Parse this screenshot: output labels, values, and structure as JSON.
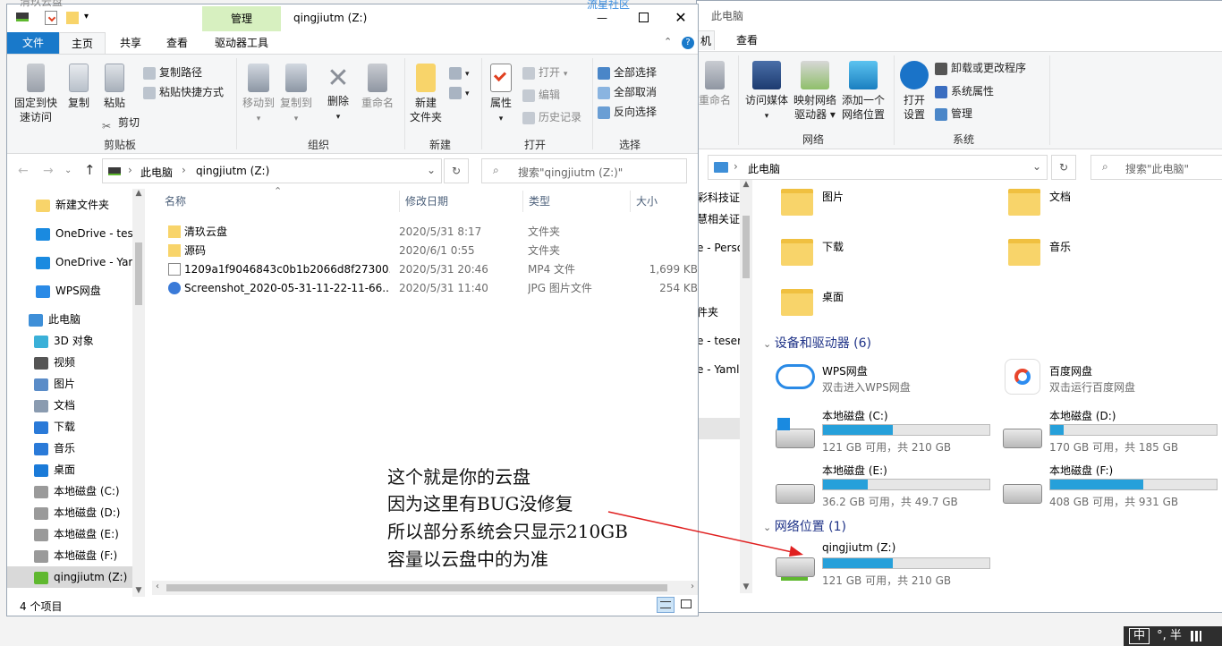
{
  "colors": {
    "accent": "#1979ca",
    "drive_fill": "#26a0da",
    "manage_tab": "#d7f0c0",
    "arrow": "#e02020"
  },
  "back_window": {
    "title": "此电脑",
    "tabs": [
      "机",
      "查看"
    ],
    "ribbon": {
      "rename": "重命名",
      "access_media": "访问媒体",
      "map_drive_1": "映射网络",
      "map_drive_2": "驱动器",
      "add_location_1": "添加一个",
      "add_location_2": "网络位置",
      "open_settings_1": "打开",
      "open_settings_2": "设置",
      "uninstall": "卸载或更改程序",
      "system_props": "系统属性",
      "manage": "管理",
      "group_network": "网络",
      "group_system": "系统"
    },
    "address": "此电脑",
    "search_placeholder": "搜索\"此电脑\"",
    "nav_partial": [
      "彩科技证",
      "慧相关证",
      "e - Perso",
      "件夹",
      "e - teser",
      "e - Yaml"
    ],
    "folders": [
      {
        "name": "图片"
      },
      {
        "name": "文档"
      },
      {
        "name": "下载"
      },
      {
        "name": "音乐"
      },
      {
        "name": "桌面"
      }
    ],
    "devices_title": "设备和驱动器 (6)",
    "cloud": [
      {
        "name": "WPS网盘",
        "sub": "双击进入WPS网盘"
      },
      {
        "name": "百度网盘",
        "sub": "双击运行百度网盘"
      }
    ],
    "drives": [
      {
        "name": "本地磁盘 (C:)",
        "sub": "121 GB 可用，共 210 GB",
        "used": 0.42
      },
      {
        "name": "本地磁盘 (D:)",
        "sub": "170 GB 可用，共 185 GB",
        "used": 0.08
      },
      {
        "name": "本地磁盘 (E:)",
        "sub": "36.2 GB 可用，共 49.7 GB",
        "used": 0.27
      },
      {
        "name": "本地磁盘 (F:)",
        "sub": "408 GB 可用，共 931 GB",
        "used": 0.56
      }
    ],
    "network_title": "网络位置 (1)",
    "network_drive": {
      "name": "qingjiutm (Z:)",
      "sub": "121 GB 可用，共 210 GB",
      "used": 0.42
    }
  },
  "front_window": {
    "title": "qingjiutm (Z:)",
    "manage_tab": "管理",
    "tabs": [
      "文件",
      "主页",
      "共享",
      "查看",
      "驱动器工具"
    ],
    "ribbon": {
      "pin_1": "固定到快",
      "pin_2": "速访问",
      "copy": "复制",
      "paste": "粘贴",
      "copy_path": "复制路径",
      "paste_shortcut": "粘贴快捷方式",
      "cut": "剪切",
      "group_clipboard": "剪贴板",
      "move_to": "移动到",
      "copy_to": "复制到",
      "delete": "删除",
      "rename": "重命名",
      "group_organize": "组织",
      "new_folder_1": "新建",
      "new_folder_2": "文件夹",
      "group_new": "新建",
      "properties": "属性",
      "open": "打开",
      "edit": "编辑",
      "history": "历史记录",
      "group_open": "打开",
      "select_all": "全部选择",
      "select_none": "全部取消",
      "invert": "反向选择",
      "group_select": "选择"
    },
    "breadcrumb": [
      "此电脑",
      "qingjiutm (Z:)"
    ],
    "search_placeholder": "搜索\"qingjiutm (Z:)\"",
    "nav": [
      {
        "label": "新建文件夹",
        "icon": "folder-icon"
      },
      {
        "label": "OneDrive - teser",
        "icon": "cloud-icon"
      },
      {
        "label": "OneDrive - Yaml",
        "icon": "cloud-icon"
      },
      {
        "label": "WPS网盘",
        "icon": "wps-cloud-icon"
      },
      {
        "label": "此电脑",
        "icon": "computer-icon"
      },
      {
        "label": "3D 对象",
        "icon": "cube-icon"
      },
      {
        "label": "视频",
        "icon": "video-icon"
      },
      {
        "label": "图片",
        "icon": "picture-icon"
      },
      {
        "label": "文档",
        "icon": "document-icon"
      },
      {
        "label": "下载",
        "icon": "download-icon"
      },
      {
        "label": "音乐",
        "icon": "music-icon"
      },
      {
        "label": "桌面",
        "icon": "desktop-icon"
      },
      {
        "label": "本地磁盘 (C:)",
        "icon": "drive-icon"
      },
      {
        "label": "本地磁盘 (D:)",
        "icon": "drive-icon"
      },
      {
        "label": "本地磁盘 (E:)",
        "icon": "drive-icon"
      },
      {
        "label": "本地磁盘 (F:)",
        "icon": "drive-icon"
      },
      {
        "label": "qingjiutm (Z:)",
        "icon": "network-drive-icon"
      }
    ],
    "columns": [
      "名称",
      "修改日期",
      "类型",
      "大小"
    ],
    "files": [
      {
        "name": "清玖云盘",
        "date": "2020/5/31 8:17",
        "type": "文件夹",
        "size": "",
        "icon": "folder-icon"
      },
      {
        "name": "源码",
        "date": "2020/6/1 0:55",
        "type": "文件夹",
        "size": "",
        "icon": "folder-icon"
      },
      {
        "name": "1209a1f9046843c0b1b2066d8f27300...",
        "date": "2020/5/31 20:46",
        "type": "MP4 文件",
        "size": "1,699 KB",
        "icon": "video-file-icon"
      },
      {
        "name": "Screenshot_2020-05-31-11-22-11-66...",
        "date": "2020/5/31 11:40",
        "type": "JPG 图片文件",
        "size": "254 KB",
        "icon": "jpg-file-icon"
      }
    ],
    "status": "4 个项目"
  },
  "annotation": [
    "这个就是你的云盘",
    "因为这里有BUG没修复",
    "所以部分系统会只显示210GB",
    "容量以云盘中的为准"
  ],
  "top_left_partial": "清玖云盘",
  "watermark": "流星社区",
  "ime": {
    "label": "中",
    "rest": "°, 半"
  }
}
